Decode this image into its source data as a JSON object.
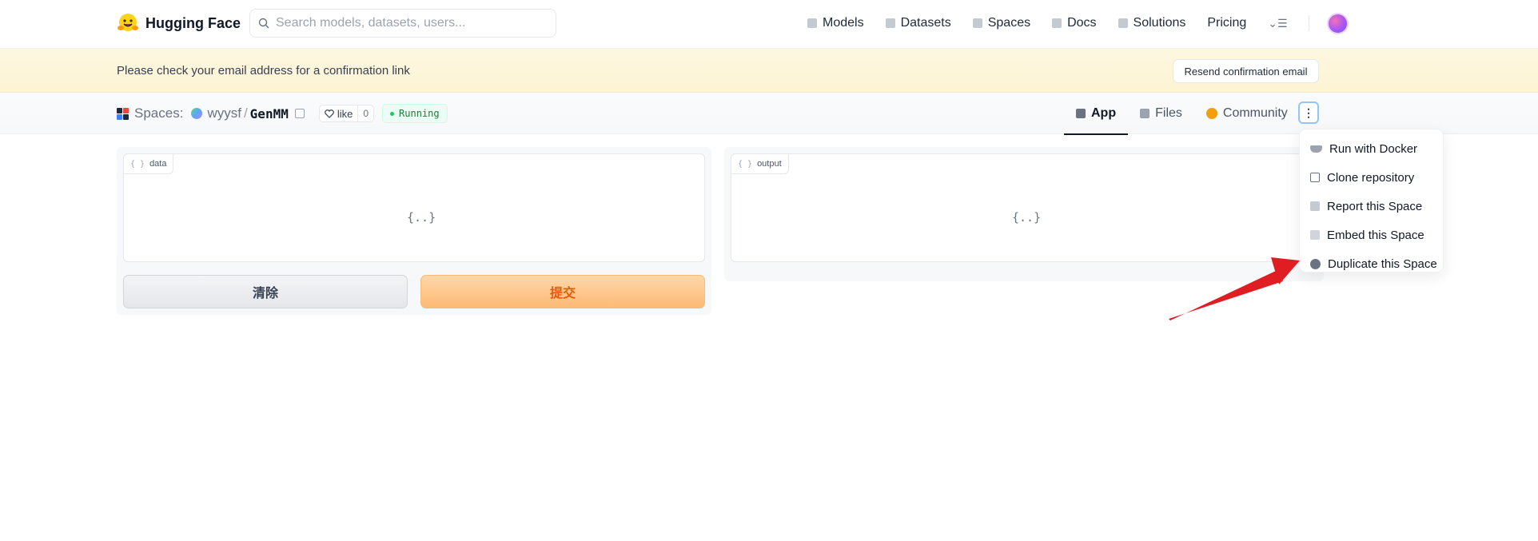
{
  "brand": {
    "name": "Hugging Face"
  },
  "search": {
    "placeholder": "Search models, datasets, users..."
  },
  "nav": {
    "links": [
      {
        "label": "Models",
        "icon": "models-icon"
      },
      {
        "label": "Datasets",
        "icon": "datasets-icon"
      },
      {
        "label": "Spaces",
        "icon": "spaces-icon"
      },
      {
        "label": "Docs",
        "icon": "docs-icon"
      },
      {
        "label": "Solutions",
        "icon": "solutions-icon"
      },
      {
        "label": "Pricing"
      }
    ]
  },
  "banner": {
    "message": "Please check your email address for a confirmation link",
    "resend_label": "Resend confirmation email"
  },
  "space": {
    "prefix": "Spaces:",
    "owner": "wyysf",
    "separator": "/",
    "name": "GenMM",
    "like_label": "like",
    "like_count": "0",
    "status": "Running"
  },
  "tabs": [
    {
      "label": "App",
      "active": true
    },
    {
      "label": "Files",
      "active": false
    },
    {
      "label": "Community",
      "active": false
    }
  ],
  "kebab_label": "⋮",
  "app": {
    "input": {
      "label": "data",
      "placeholder": "{..}"
    },
    "output": {
      "label": "output",
      "placeholder": "{..}"
    },
    "clear_label": "清除",
    "submit_label": "提交"
  },
  "menu": {
    "items": [
      {
        "label": "Run with Docker"
      },
      {
        "label": "Clone repository"
      },
      {
        "label": "Report this Space"
      },
      {
        "label": "Embed this Space"
      },
      {
        "label": "Duplicate this Space"
      }
    ]
  },
  "colors": {
    "accent_orange": "#ea580c",
    "running_green": "#15803d",
    "annotation_arrow": "#e11d24",
    "banner_bg": "#fef7e0"
  }
}
